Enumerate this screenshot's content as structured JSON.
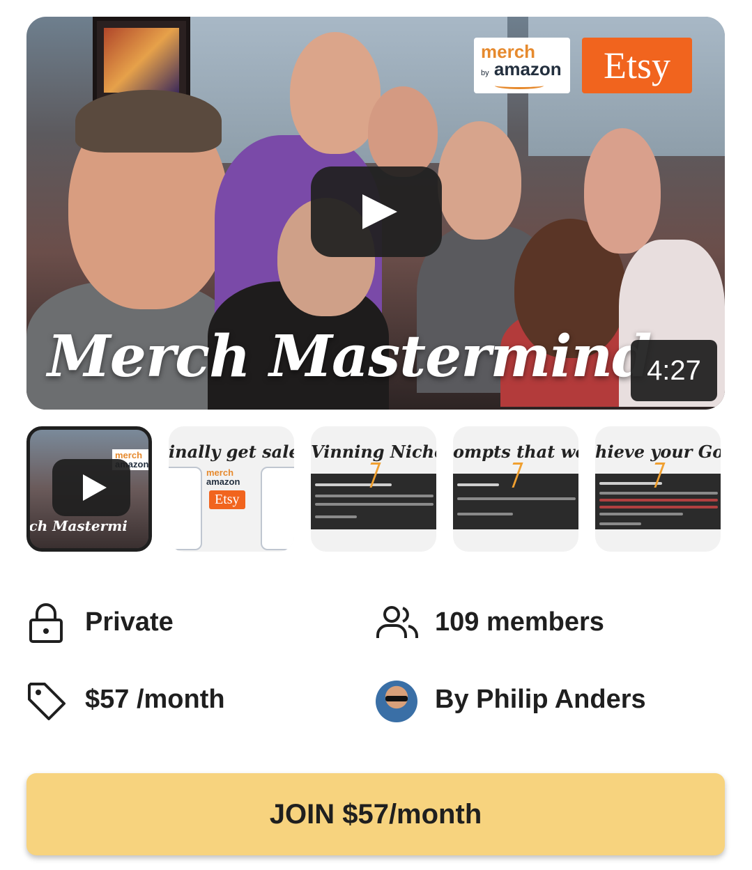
{
  "video": {
    "caption": "Merch Mastermind",
    "duration": "4:27",
    "logos": {
      "merch_top": "merch",
      "merch_by": "by",
      "merch_bottom": "amazon",
      "etsy": "Etsy"
    }
  },
  "thumbnails": [
    {
      "caption": "rch Mastermi",
      "active": true
    },
    {
      "caption": "inally get sale",
      "etsy": "Etsy",
      "merch_top": "merch",
      "merch_bottom": "amazon"
    },
    {
      "caption": "Vinning Niche"
    },
    {
      "caption": "ompts that we"
    },
    {
      "caption": "hieve your Go"
    }
  ],
  "info": {
    "privacy": "Private",
    "members": "109 members",
    "price": "$57 /month",
    "owner": "By Philip Anders"
  },
  "join_button": "JOIN $57/month",
  "colors": {
    "join_bg": "#f7d37e",
    "etsy_orange": "#f1641e",
    "merch_orange": "#e68a2e"
  }
}
